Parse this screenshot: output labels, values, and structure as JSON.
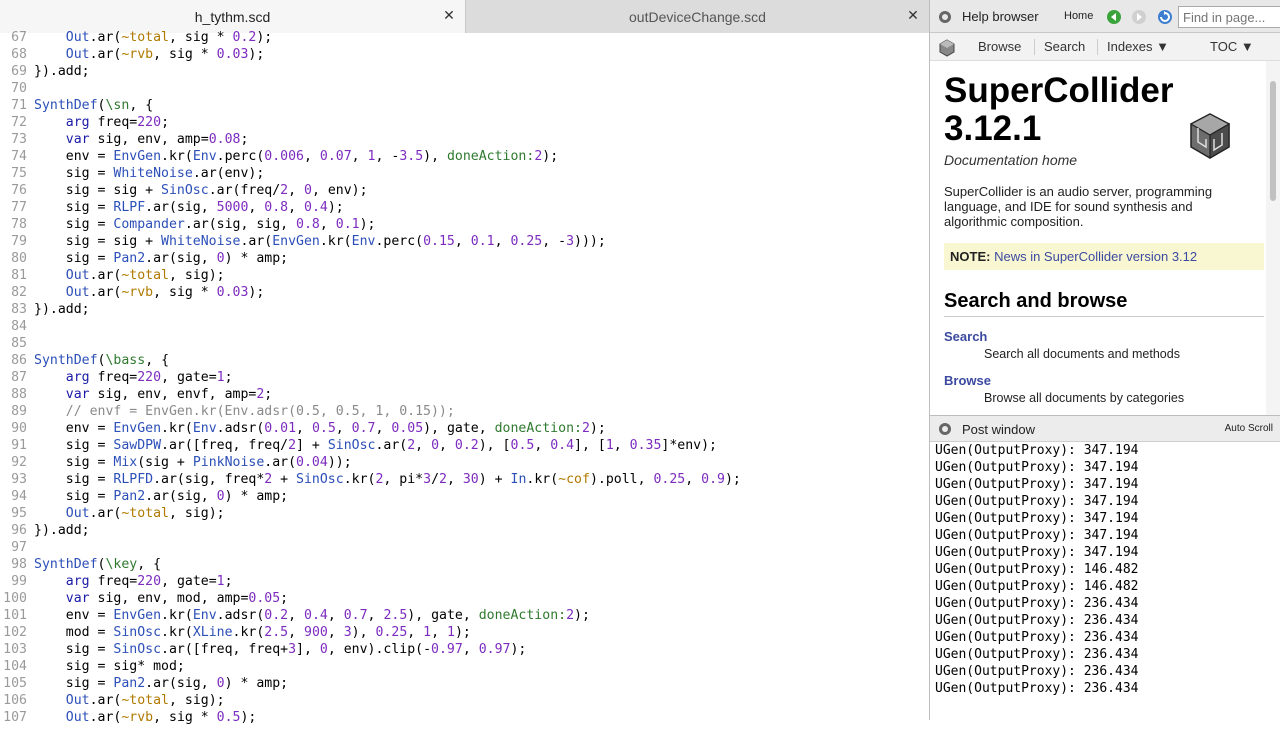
{
  "editor": {
    "tabs": [
      {
        "label": "h_tythm.scd",
        "close": "✕"
      },
      {
        "label": "outDeviceChange.scd",
        "close": "✕"
      }
    ],
    "lines": [
      {
        "n": "67",
        "t": "    Out.ar(~total, sig * 0.2);"
      },
      {
        "n": "68",
        "t": "    Out.ar(~rvb, sig * 0.03);"
      },
      {
        "n": "69",
        "t": "}).add;"
      },
      {
        "n": "70",
        "t": ""
      },
      {
        "n": "71",
        "t": "SynthDef(\\sn, {"
      },
      {
        "n": "72",
        "t": "    arg freq=220;"
      },
      {
        "n": "73",
        "t": "    var sig, env, amp=0.08;"
      },
      {
        "n": "74",
        "t": "    env = EnvGen.kr(Env.perc(0.006, 0.07, 1, -3.5), doneAction:2);"
      },
      {
        "n": "75",
        "t": "    sig = WhiteNoise.ar(env);"
      },
      {
        "n": "76",
        "t": "    sig = sig + SinOsc.ar(freq/2, 0, env);"
      },
      {
        "n": "77",
        "t": "    sig = RLPF.ar(sig, 5000, 0.8, 0.4);"
      },
      {
        "n": "78",
        "t": "    sig = Compander.ar(sig, sig, 0.8, 0.1);"
      },
      {
        "n": "79",
        "t": "    sig = sig + WhiteNoise.ar(EnvGen.kr(Env.perc(0.15, 0.1, 0.25, -3)));"
      },
      {
        "n": "80",
        "t": "    sig = Pan2.ar(sig, 0) * amp;"
      },
      {
        "n": "81",
        "t": "    Out.ar(~total, sig);"
      },
      {
        "n": "82",
        "t": "    Out.ar(~rvb, sig * 0.03);"
      },
      {
        "n": "83",
        "t": "}).add;"
      },
      {
        "n": "84",
        "t": ""
      },
      {
        "n": "85",
        "t": ""
      },
      {
        "n": "86",
        "t": "SynthDef(\\bass, {"
      },
      {
        "n": "87",
        "t": "    arg freq=220, gate=1;"
      },
      {
        "n": "88",
        "t": "    var sig, env, envf, amp=2;"
      },
      {
        "n": "89",
        "t": "    // envf = EnvGen.kr(Env.adsr(0.5, 0.5, 1, 0.15));"
      },
      {
        "n": "90",
        "t": "    env = EnvGen.kr(Env.adsr(0.01, 0.5, 0.7, 0.05), gate, doneAction:2);"
      },
      {
        "n": "91",
        "t": "    sig = SawDPW.ar([freq, freq/2] + SinOsc.ar(2, 0, 0.2), [0.5, 0.4], [1, 0.35]*env);"
      },
      {
        "n": "92",
        "t": "    sig = Mix(sig + PinkNoise.ar(0.04));"
      },
      {
        "n": "93",
        "t": "    sig = RLPFD.ar(sig, freq*2 + SinOsc.kr(2, pi*3/2, 30) + In.kr(~cof).poll, 0.25, 0.9);"
      },
      {
        "n": "94",
        "t": "    sig = Pan2.ar(sig, 0) * amp;"
      },
      {
        "n": "95",
        "t": "    Out.ar(~total, sig);"
      },
      {
        "n": "96",
        "t": "}).add;"
      },
      {
        "n": "97",
        "t": ""
      },
      {
        "n": "98",
        "t": "SynthDef(\\key, {"
      },
      {
        "n": "99",
        "t": "    arg freq=220, gate=1;"
      },
      {
        "n": "100",
        "t": "    var sig, env, mod, amp=0.05;"
      },
      {
        "n": "101",
        "t": "    env = EnvGen.kr(Env.adsr(0.2, 0.4, 0.7, 2.5), gate, doneAction:2);"
      },
      {
        "n": "102",
        "t": "    mod = SinOsc.kr(XLine.kr(2.5, 900, 3), 0.25, 1, 1);"
      },
      {
        "n": "103",
        "t": "    sig = SinOsc.ar([freq, freq+3], 0, env).clip(-0.97, 0.97);"
      },
      {
        "n": "104",
        "t": "    sig = sig* mod;"
      },
      {
        "n": "105",
        "t": "    sig = Pan2.ar(sig, 0) * amp;"
      },
      {
        "n": "106",
        "t": "    Out.ar(~total, sig);"
      },
      {
        "n": "107",
        "t": "    Out.ar(~rvb, sig * 0.5);"
      }
    ]
  },
  "help": {
    "title": "Help browser",
    "home_label": "Home",
    "find_placeholder": "Find in page...",
    "nav": {
      "browse": "Browse",
      "search": "Search",
      "indexes": "Indexes ▼",
      "toc": "TOC ▼"
    },
    "heading_line1": "SuperCollider",
    "heading_line2": "3.12.1",
    "doc_home": "Documentation home",
    "description": "SuperCollider is an audio server, programming language, and IDE for sound synthesis and algorithmic composition.",
    "note_label": "NOTE:",
    "note_link": "News in SuperCollider version 3.12",
    "section_title": "Search and browse",
    "search_link": "Search",
    "search_desc": "Search all documents and methods",
    "browse_link": "Browse",
    "browse_desc": "Browse all documents by categories"
  },
  "post": {
    "title": "Post window",
    "auto_scroll": "Auto Scroll",
    "lines": [
      "UGen(OutputProxy): 347.194",
      "UGen(OutputProxy): 347.194",
      "UGen(OutputProxy): 347.194",
      "UGen(OutputProxy): 347.194",
      "UGen(OutputProxy): 347.194",
      "UGen(OutputProxy): 347.194",
      "UGen(OutputProxy): 347.194",
      "UGen(OutputProxy): 146.482",
      "UGen(OutputProxy): 146.482",
      "UGen(OutputProxy): 236.434",
      "UGen(OutputProxy): 236.434",
      "UGen(OutputProxy): 236.434",
      "UGen(OutputProxy): 236.434",
      "UGen(OutputProxy): 236.434",
      "UGen(OutputProxy): 236.434"
    ]
  },
  "colors": {
    "keyword": "#1a1aa8",
    "class": "#2c4fb8",
    "number": "#7c2bbf",
    "env_var": "#b07a00",
    "symbol": "#2f7a2f",
    "comment": "#8a8a8a",
    "note_bg": "#f9f7d2",
    "link": "#3b4aa0"
  }
}
